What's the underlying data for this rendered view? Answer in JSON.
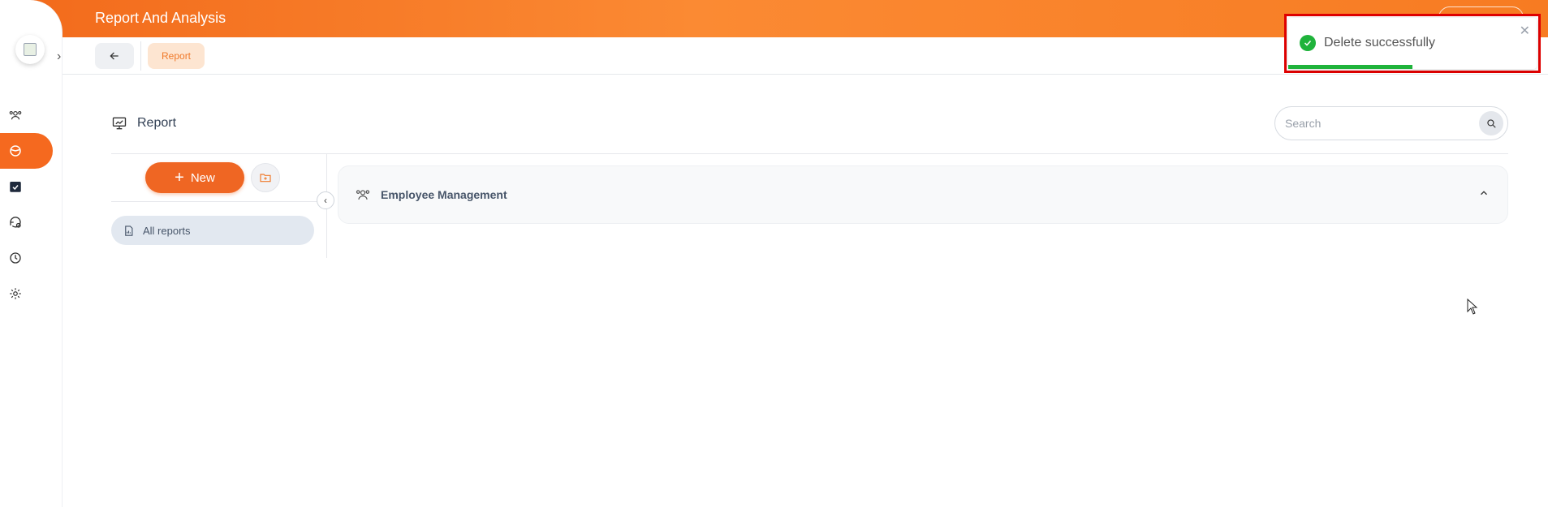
{
  "header": {
    "title": "Report And Analysis"
  },
  "toolbar": {
    "breadcrumb": "Report"
  },
  "page": {
    "title": "Report"
  },
  "search": {
    "placeholder": "Search",
    "value": ""
  },
  "left_panel": {
    "new_label": "New",
    "all_reports_label": "All reports"
  },
  "groups": [
    {
      "label": "Employee Management"
    }
  ],
  "toast": {
    "message": "Delete successfully",
    "progress": 0.5
  },
  "sidebar": {
    "items": [
      {
        "icon": "users-icon",
        "active": false
      },
      {
        "icon": "chart-pie-icon",
        "active": true
      },
      {
        "icon": "calendar-check-icon",
        "active": false
      },
      {
        "icon": "history-settings-icon",
        "active": false
      },
      {
        "icon": "clock-history-icon",
        "active": false
      },
      {
        "icon": "gear-icon",
        "active": false
      }
    ]
  },
  "colors": {
    "accent": "#f5691f",
    "success": "#1fb33b",
    "highlight": "#e00000"
  }
}
